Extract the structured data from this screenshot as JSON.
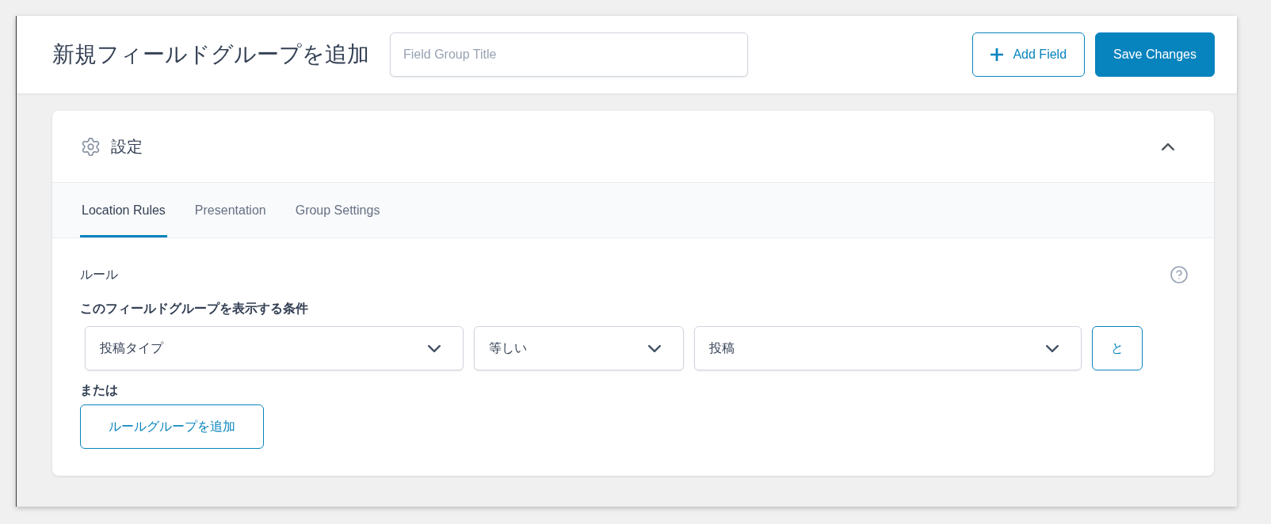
{
  "header": {
    "title": "新規フィールドグループを追加",
    "title_field": {
      "placeholder": "Field Group Title"
    },
    "buttons": [
      {
        "label": "Add Field",
        "kind": "add"
      },
      {
        "label": "Save Changes",
        "kind": "primary"
      }
    ]
  },
  "panel": {
    "title": "設定",
    "expanded": true,
    "tabs": [
      {
        "label": "Location Rules",
        "selected": true
      },
      {
        "label": "Presentation",
        "selected": false
      },
      {
        "label": "Group Settings",
        "selected": false
      }
    ],
    "rules": {
      "label": "ルール",
      "heading": "このフィールドグループを表示する条件",
      "rule_groups": [
        {
          "conditions": [
            {
              "param": "投稿タイプ",
              "operator": "等しい",
              "value": "投稿",
              "and_button": "と"
            }
          ]
        }
      ],
      "or_label": "または",
      "add_group_button": "ルールグループを追加"
    }
  }
}
